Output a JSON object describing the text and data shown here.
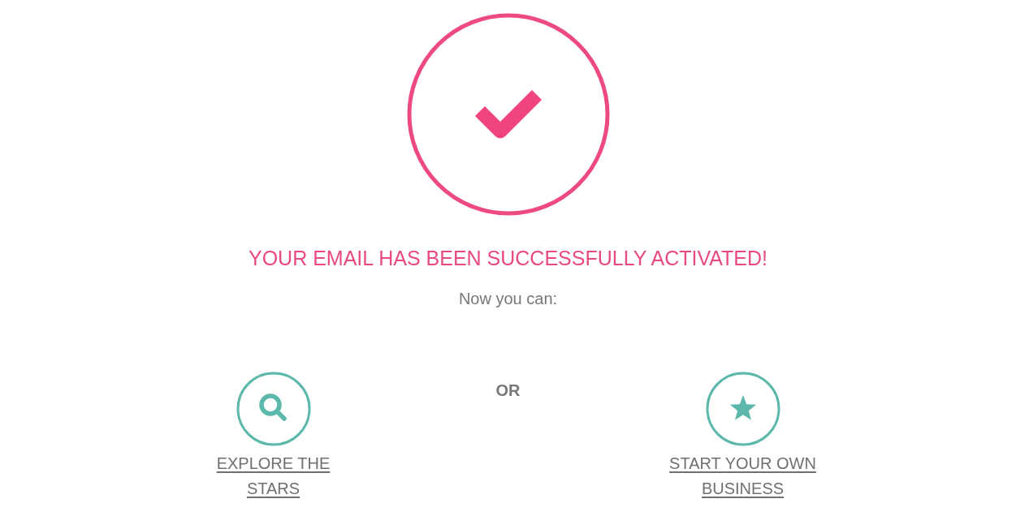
{
  "heading": "YOUR EMAIL HAS BEEN SUCCESSFULLY ACTIVATED!",
  "subheading": "Now you can:",
  "options": [
    {
      "kind": "search",
      "label": "EXPLORE THE STARS"
    },
    {
      "kind": "star",
      "label": "START YOUR OWN BUSINESS"
    }
  ],
  "separator": "OR"
}
